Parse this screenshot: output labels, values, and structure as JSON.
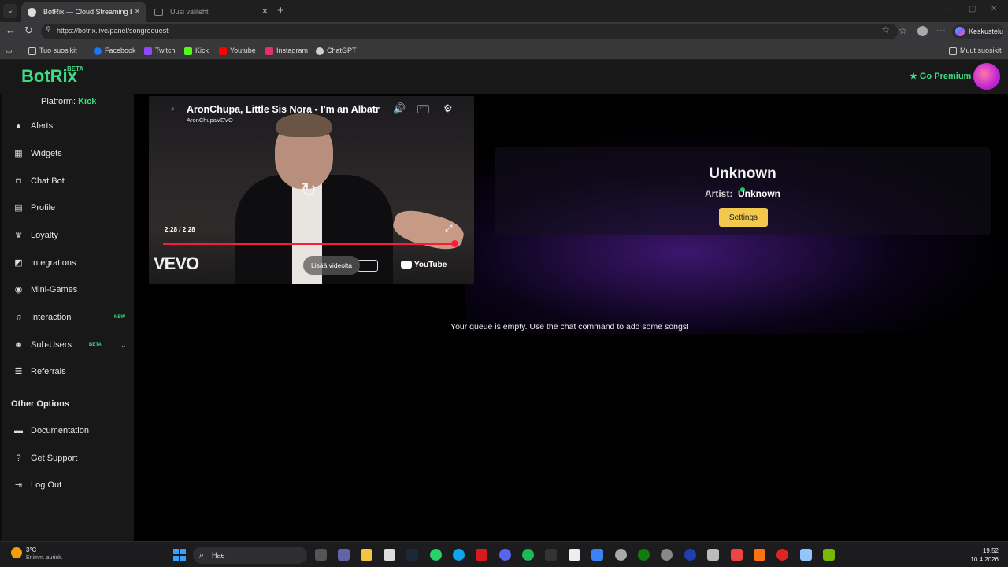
{
  "browser": {
    "tabs": [
      {
        "label": "BotRix — Cloud Streaming Bot for",
        "active": true
      },
      {
        "label": "Uusi välilehti",
        "active": false
      }
    ],
    "url": "https://botrix.live/panel/songrequest",
    "copilot_label": "Keskustelu",
    "bookmarks": [
      {
        "label": "Tuo suosikit",
        "icon": "import-icon",
        "color": "#cccccc"
      },
      {
        "label": "Facebook",
        "icon": "facebook-icon",
        "color": "#1877f2"
      },
      {
        "label": "Twitch",
        "icon": "twitch-icon",
        "color": "#9146ff"
      },
      {
        "label": "Kick",
        "icon": "kick-icon",
        "color": "#53fc18"
      },
      {
        "label": "Youtube",
        "icon": "youtube-icon",
        "color": "#ff0000"
      },
      {
        "label": "Instagram",
        "icon": "instagram-icon",
        "color": "#e1306c"
      },
      {
        "label": "ChatGPT",
        "icon": "chatgpt-icon",
        "color": "#d0d0d0"
      }
    ],
    "other_bookmarks": "Muut suosikit"
  },
  "app": {
    "logo": "BotRix",
    "logo_badge": "BETA",
    "premium_label": "Go Premium",
    "platform_label": "Platform:",
    "platform_value": "Kick",
    "nav": [
      {
        "label": "Alerts",
        "icon": "warning-icon"
      },
      {
        "label": "Widgets",
        "icon": "grid-icon"
      },
      {
        "label": "Chat Bot",
        "icon": "robot-icon"
      },
      {
        "label": "Profile",
        "icon": "id-card-icon"
      },
      {
        "label": "Loyalty",
        "icon": "trophy-icon"
      },
      {
        "label": "Integrations",
        "icon": "puzzle-icon"
      },
      {
        "label": "Mini-Games",
        "icon": "gamepad-icon"
      },
      {
        "label": "Interaction",
        "icon": "music-icon",
        "tag": "NEW"
      },
      {
        "label": "Sub-Users",
        "icon": "users-icon",
        "tag": "BETA"
      },
      {
        "label": "Referrals",
        "icon": "list-icon"
      }
    ],
    "other_options_title": "Other Options",
    "other_nav": [
      {
        "label": "Documentation",
        "icon": "book-icon"
      },
      {
        "label": "Get Support",
        "icon": "question-icon"
      },
      {
        "label": "Log Out",
        "icon": "logout-icon"
      }
    ]
  },
  "player": {
    "title": "AronChupa, Little Sis Nora - I'm an Albatraoz",
    "channel": "AronChupaVEVO",
    "time_current": "2:28",
    "time_total": "2:28",
    "progress": 1.0,
    "watch_on_label": "Lisää videolta",
    "youtube_label": "YouTube",
    "vevo_label": "VEVO"
  },
  "now_playing": {
    "title": "Unknown",
    "artist_label": "Artist:",
    "artist_value": "Unknown",
    "settings_label": "Settings",
    "status_color": "#22c55e"
  },
  "queue": {
    "empty_message": "Your queue is empty. Use the chat command to add some songs!"
  },
  "taskbar": {
    "temperature": "3°C",
    "weather": "Enimm. aurink.",
    "search_placeholder": "Hae",
    "time": "19.52",
    "date": "10.4.2026"
  }
}
